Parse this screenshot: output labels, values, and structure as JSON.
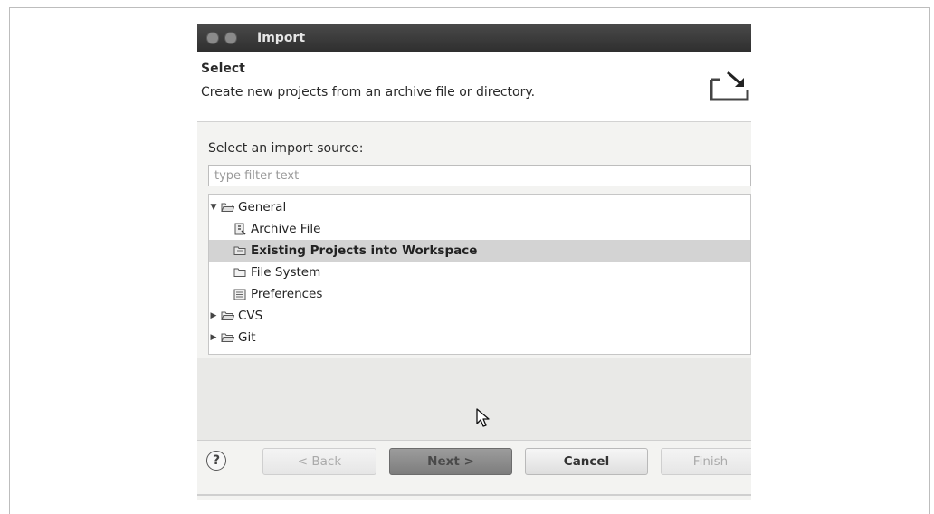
{
  "window": {
    "title": "Import"
  },
  "header": {
    "title": "Select",
    "description": "Create new projects from an archive file or directory."
  },
  "source": {
    "label": "Select an import source:",
    "filter_placeholder": "type filter text",
    "filter_value": ""
  },
  "tree": {
    "items": [
      {
        "label": "General",
        "icon": "folder-open-icon",
        "level": 0,
        "expanded": true
      },
      {
        "label": "Archive File",
        "icon": "archive-file-icon",
        "level": 1
      },
      {
        "label": "Existing Projects into Workspace",
        "icon": "project-icon",
        "level": 1,
        "selected": true
      },
      {
        "label": "File System",
        "icon": "folder-icon",
        "level": 1
      },
      {
        "label": "Preferences",
        "icon": "preferences-icon",
        "level": 1
      },
      {
        "label": "CVS",
        "icon": "folder-icon",
        "level": 0,
        "expanded": false
      },
      {
        "label": "Git",
        "icon": "folder-icon",
        "level": 0,
        "expanded": false
      }
    ]
  },
  "buttons": {
    "help": "?",
    "back": "< Back",
    "next": "Next >",
    "cancel": "Cancel",
    "finish": "Finish"
  },
  "colors": {
    "titlebar": "#2e2e2e",
    "selection": "#d3d3d3",
    "default_button": "#8a8a8a"
  }
}
